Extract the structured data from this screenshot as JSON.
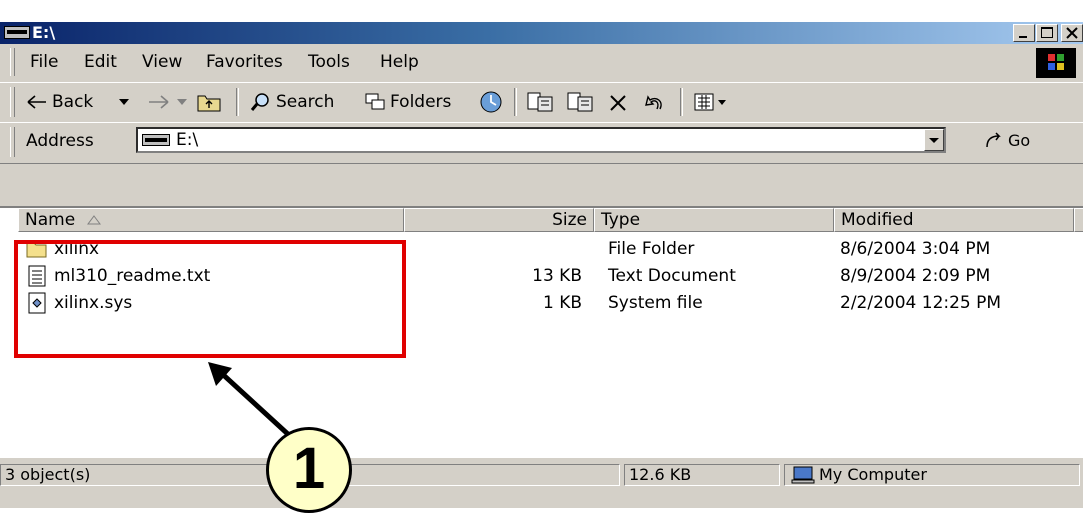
{
  "window": {
    "title": "E:\\"
  },
  "menu": [
    {
      "label": "File"
    },
    {
      "label": "Edit"
    },
    {
      "label": "View"
    },
    {
      "label": "Favorites"
    },
    {
      "label": "Tools"
    },
    {
      "label": "Help"
    }
  ],
  "toolbar": {
    "back_label": "Back",
    "search_label": "Search",
    "folders_label": "Folders",
    "icons": [
      "back-arrow-icon",
      "dropdown-arrow-icon",
      "forward-arrow-icon",
      "up-folder-icon",
      "search-icon",
      "folders-icon",
      "history-icon",
      "move-to-icon",
      "copy-to-icon",
      "delete-icon",
      "undo-icon",
      "views-icon"
    ]
  },
  "address": {
    "label": "Address",
    "value": "E:\\",
    "go_label": "Go"
  },
  "list": {
    "columns": {
      "name": "Name",
      "size": "Size",
      "type": "Type",
      "modified": "Modified"
    },
    "rows": [
      {
        "name": "xilinx",
        "size": "",
        "type": "File Folder",
        "modified": "8/6/2004 3:04 PM",
        "icon": "folder-icon"
      },
      {
        "name": "ml310_readme.txt",
        "size": "13 KB",
        "type": "Text Document",
        "modified": "8/9/2004 2:09 PM",
        "icon": "text-file-icon"
      },
      {
        "name": "xilinx.sys",
        "size": "1 KB",
        "type": "System file",
        "modified": "2/2/2004 12:25 PM",
        "icon": "system-file-icon"
      }
    ]
  },
  "status": {
    "objects": "3 object(s)",
    "size": "12.6 KB",
    "location": "My Computer"
  },
  "annotation": {
    "callout_number": "1"
  },
  "colors": {
    "highlight": "#e00000",
    "callout_fill": "#ffffc8",
    "titlebar_start": "#0a246a",
    "titlebar_end": "#a6caf0"
  }
}
